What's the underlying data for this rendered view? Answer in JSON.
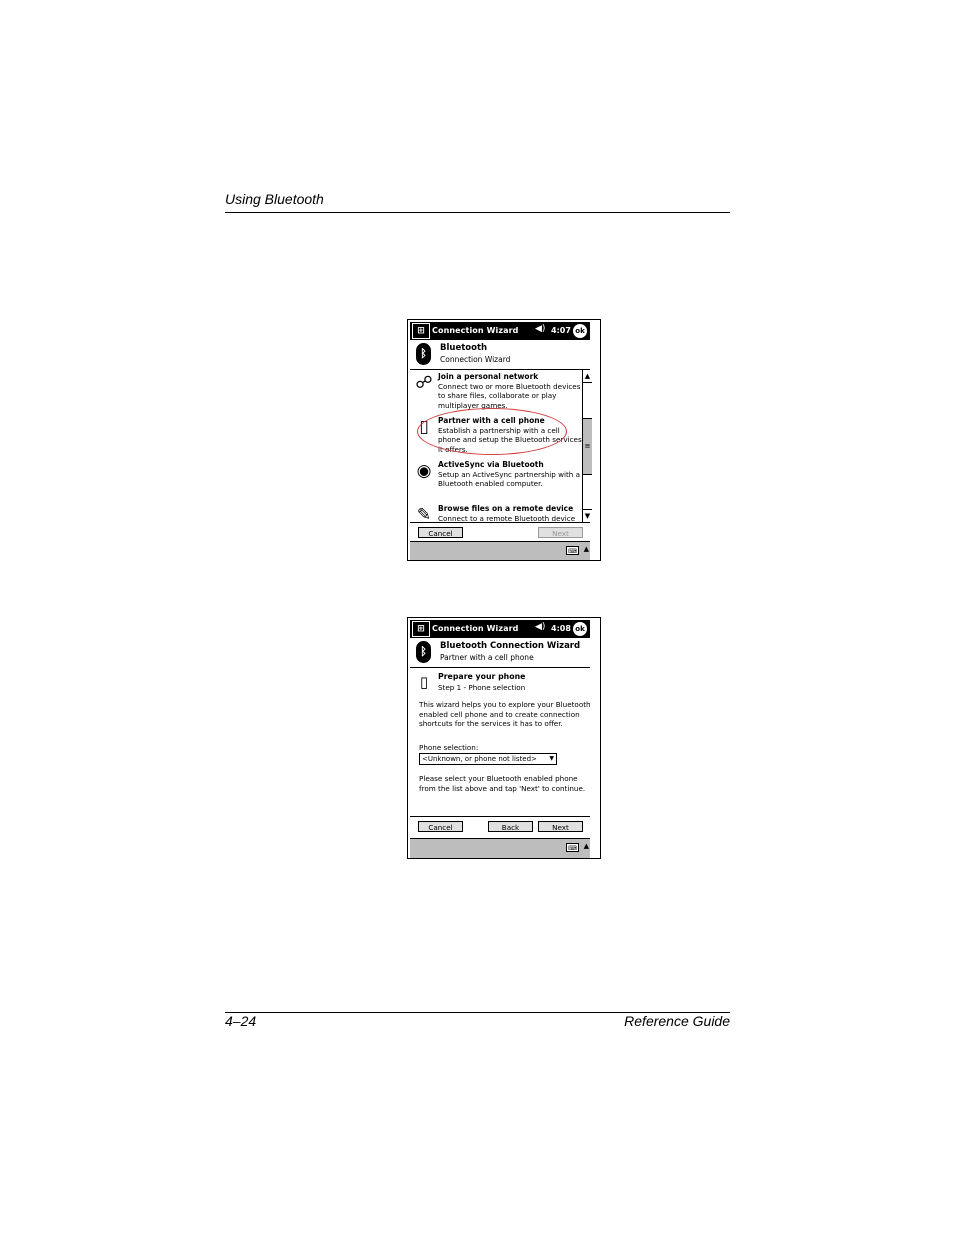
{
  "page": {
    "header_title": "Using Bluetooth",
    "footer_left": "4–24",
    "footer_right": "Reference Guide"
  },
  "screen1": {
    "title": "Connection Wizard",
    "time": "4:07",
    "ok_label": "ok",
    "head_title": "Bluetooth",
    "head_subtitle": "Connection Wizard",
    "items": [
      {
        "title": "Join a personal network",
        "description": "Connect two or more Bluetooth devices to share files, collaborate or play multiplayer games."
      },
      {
        "title": "Partner with a cell phone",
        "description": "Establish a partnership with a cell phone and setup the Bluetooth services it offers."
      },
      {
        "title": "ActiveSync via Bluetooth",
        "description": "Setup an ActiveSync partnership with a Bluetooth enabled computer."
      },
      {
        "title": "Browse files on a remote device",
        "description": "Connect to a remote Bluetooth device"
      }
    ],
    "cancel_label": "Cancel",
    "next_label": "Next"
  },
  "screen2": {
    "title": "Connection Wizard",
    "time": "4:08",
    "ok_label": "ok",
    "head_title": "Bluetooth Connection Wizard",
    "head_subtitle": "Partner with a cell phone",
    "step_title": "Prepare your phone",
    "step_subtitle": "Step 1 - Phone selection",
    "paragraph1": "This wizard helps you to explore your Bluetooth enabled cell phone and to create connection shortcuts for the services it has to offer.",
    "selection_label": "Phone selection:",
    "selection_value": "<Unknown, or phone not listed>",
    "paragraph2": "Please select your Bluetooth enabled phone from the list above and tap 'Next' to continue.",
    "cancel_label": "Cancel",
    "back_label": "Back",
    "next_label": "Next"
  }
}
